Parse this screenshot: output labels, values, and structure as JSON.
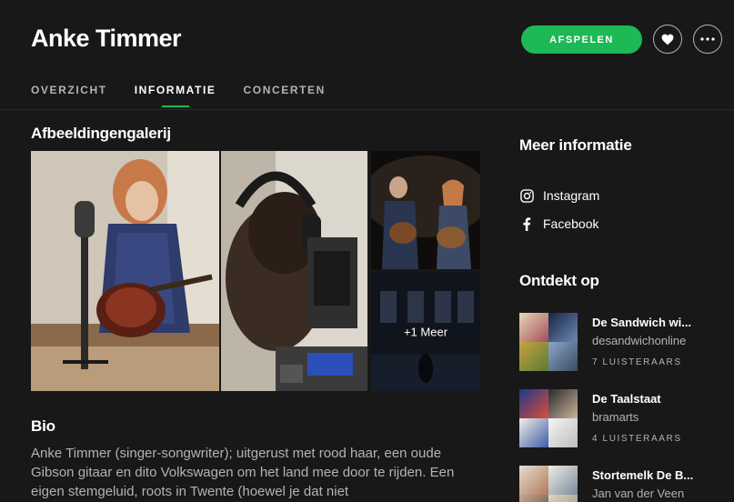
{
  "artist": {
    "name": "Anke Timmer"
  },
  "actions": {
    "play_label": "AFSPELEN"
  },
  "tabs": [
    {
      "label": "OVERZICHT",
      "active": false
    },
    {
      "label": "INFORMATIE",
      "active": true
    },
    {
      "label": "CONCERTEN",
      "active": false
    }
  ],
  "gallery": {
    "title": "Afbeeldingengalerij",
    "more_label": "+1 Meer"
  },
  "bio": {
    "title": "Bio",
    "text": "Anke Timmer (singer-songwriter); uitgerust met rood haar, een oude Gibson gitaar en dito Volkswagen om het land mee door te rijden. Een eigen stemgeluid, roots in Twente (hoewel je dat niet"
  },
  "more_info": {
    "title": "Meer informatie",
    "links": [
      {
        "label": "Instagram",
        "icon": "instagram-icon"
      },
      {
        "label": "Facebook",
        "icon": "facebook-icon"
      }
    ]
  },
  "discovered_on": {
    "title": "Ontdekt op",
    "playlists": [
      {
        "name": "De Sandwich wi...",
        "owner": "desandwichonline",
        "listeners": "7 LUISTERAARS"
      },
      {
        "name": "De Taalstaat",
        "owner": "bramarts",
        "listeners": "4 LUISTERAARS"
      },
      {
        "name": "Stortemelk De B...",
        "owner": "Jan van der Veen",
        "listeners": ""
      }
    ]
  },
  "colors": {
    "accent": "#1db954",
    "background": "#181818",
    "muted_text": "#b3b3b3"
  }
}
